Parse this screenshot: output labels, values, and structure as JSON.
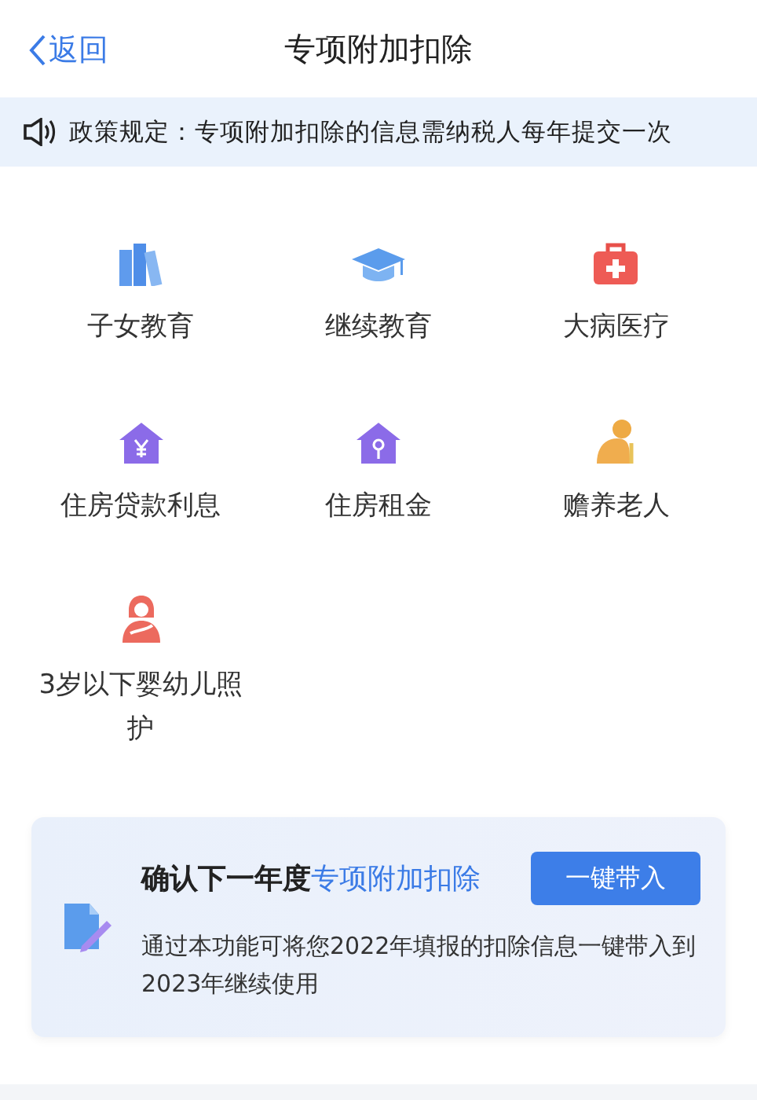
{
  "nav": {
    "back": "返回",
    "title": "专项附加扣除"
  },
  "notice": "政策规定：专项附加扣除的信息需纳税人每年提交一次",
  "items": [
    {
      "kind": "books",
      "label": "子女教育"
    },
    {
      "kind": "cap",
      "label": "继续教育"
    },
    {
      "kind": "medkit",
      "label": "大病医疗"
    },
    {
      "kind": "house-yuan",
      "label": "住房贷款利息"
    },
    {
      "kind": "house-key",
      "label": "住房租金"
    },
    {
      "kind": "elder",
      "label": "赡养老人"
    },
    {
      "kind": "mother",
      "label": "3岁以下婴幼儿照护"
    }
  ],
  "card": {
    "title_lead": "确认下一年度",
    "title_highlight": "专项附加扣除",
    "button": "一键带入",
    "description": "通过本功能可将您2022年填报的扣除信息一键带入到2023年继续使用"
  }
}
